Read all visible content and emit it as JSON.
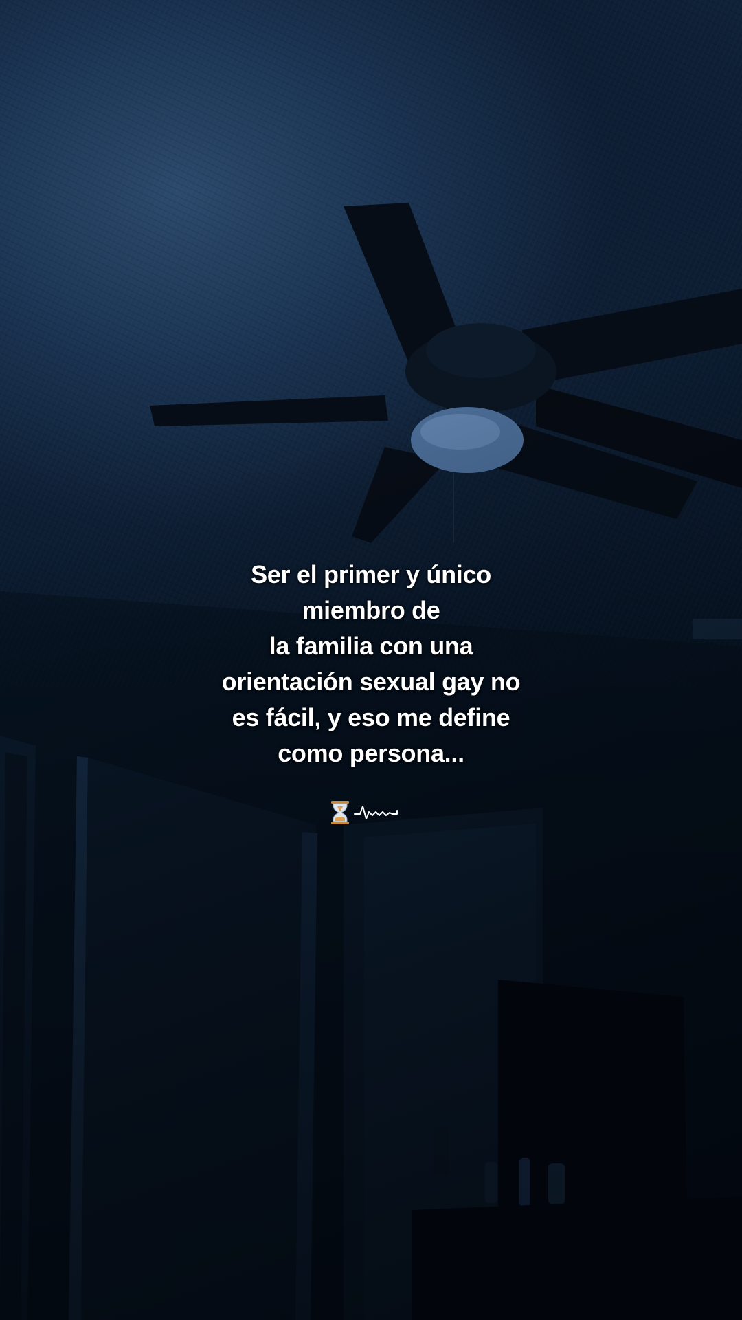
{
  "caption": {
    "lines": [
      "Ser el primer y único",
      "miembro de",
      "la familia con una",
      "orientación sexual gay no",
      "es fácil, y eso me define",
      "como persona..."
    ]
  },
  "decorations": {
    "icons": [
      "hourglass-icon",
      "heartbeat-line-icon"
    ]
  },
  "colors": {
    "caption_text": "#ffffff",
    "scene_dark": "#050a12",
    "scene_blue": "#1b3452"
  }
}
